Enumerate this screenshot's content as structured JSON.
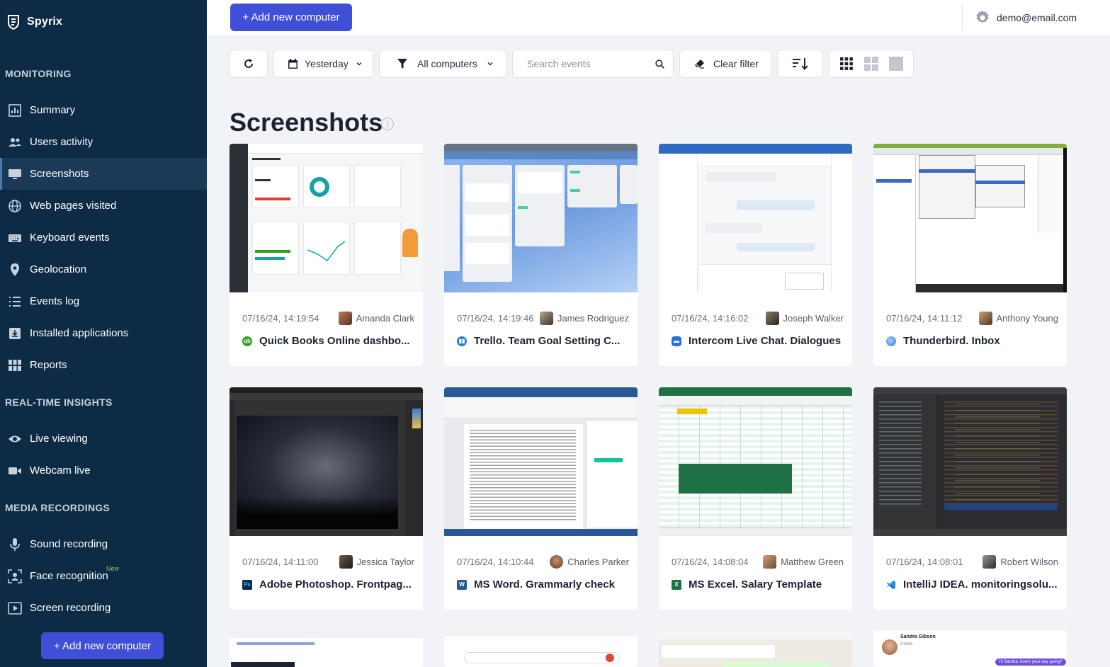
{
  "brand": {
    "name": "Spyrix"
  },
  "sidebar": {
    "sections": [
      {
        "title": "MONITORING"
      },
      {
        "title": "REAL-TIME INSIGHTS"
      },
      {
        "title": "MEDIA RECORDINGS"
      }
    ],
    "items": [
      {
        "label": "Summary",
        "icon": "bar-chart-icon"
      },
      {
        "label": "Users activity",
        "icon": "users-icon"
      },
      {
        "label": "Screenshots",
        "icon": "monitor-icon"
      },
      {
        "label": "Web pages visited",
        "icon": "globe-icon"
      },
      {
        "label": "Keyboard events",
        "icon": "keyboard-icon"
      },
      {
        "label": "Geolocation",
        "icon": "location-pin-icon"
      },
      {
        "label": "Events log",
        "icon": "list-icon"
      },
      {
        "label": "Installed applications",
        "icon": "install-icon"
      },
      {
        "label": "Reports",
        "icon": "grid-icon"
      },
      {
        "label": "Live viewing",
        "icon": "eye-icon"
      },
      {
        "label": "Webcam live",
        "icon": "video-camera-icon"
      },
      {
        "label": "Sound recording",
        "icon": "microphone-icon"
      },
      {
        "label": "Face recognition",
        "icon": "face-scan-icon",
        "badge": "New"
      },
      {
        "label": "Screen recording",
        "icon": "play-screen-icon"
      }
    ],
    "add_button": "+ Add new computer"
  },
  "topbar": {
    "add_button": "+ Add new computer",
    "user_email": "demo@email.com"
  },
  "filters": {
    "date": "Yesterday",
    "computers": "All computers",
    "search_placeholder": "Search events",
    "clear": "Clear filter"
  },
  "page": {
    "title": "Screenshots",
    "info": "i"
  },
  "screenshots": [
    {
      "time": "07/16/24, 14:19:54",
      "user": "Amanda Clark",
      "app": "Quick Books Online dashbo...",
      "app_color": "#2ca01c"
    },
    {
      "time": "07/16/24, 14:19:46",
      "user": "James Rodriguez",
      "app": "Trello. Team Goal Setting C...",
      "app_color": "#1d7fd6"
    },
    {
      "time": "07/16/24, 14:16:02",
      "user": "Joseph Walker",
      "app": "Intercom Live Chat. Dialogues",
      "app_color": "#2a6fe0"
    },
    {
      "time": "07/16/24, 14:11:12",
      "user": "Anthony Young",
      "app": "Thunderbird. Inbox",
      "app_color": "#3b7bd0"
    },
    {
      "time": "07/16/24, 14:11:00",
      "user": "Jessica Taylor",
      "app": "Adobe Photoshop. Frontpag...",
      "app_color": "#0d2b45"
    },
    {
      "time": "07/16/24, 14:10:44",
      "user": "Charles Parker",
      "app": "MS Word. Grammarly check",
      "app_color": "#2b5797"
    },
    {
      "time": "07/16/24, 14:08:04",
      "user": "Matthew Green",
      "app": "MS Excel. Salary Template",
      "app_color": "#1e7145"
    },
    {
      "time": "07/16/24, 14:08:01",
      "user": "Robert Wilson",
      "app": "IntelliJ IDEA. monitoringsolu...",
      "app_color": "#1e88e5"
    }
  ],
  "partial_row": {
    "chat_name": "Sandra Gibson",
    "chat_status": "Online",
    "chat_msg": "Hi Sandra, how's your day going?"
  }
}
